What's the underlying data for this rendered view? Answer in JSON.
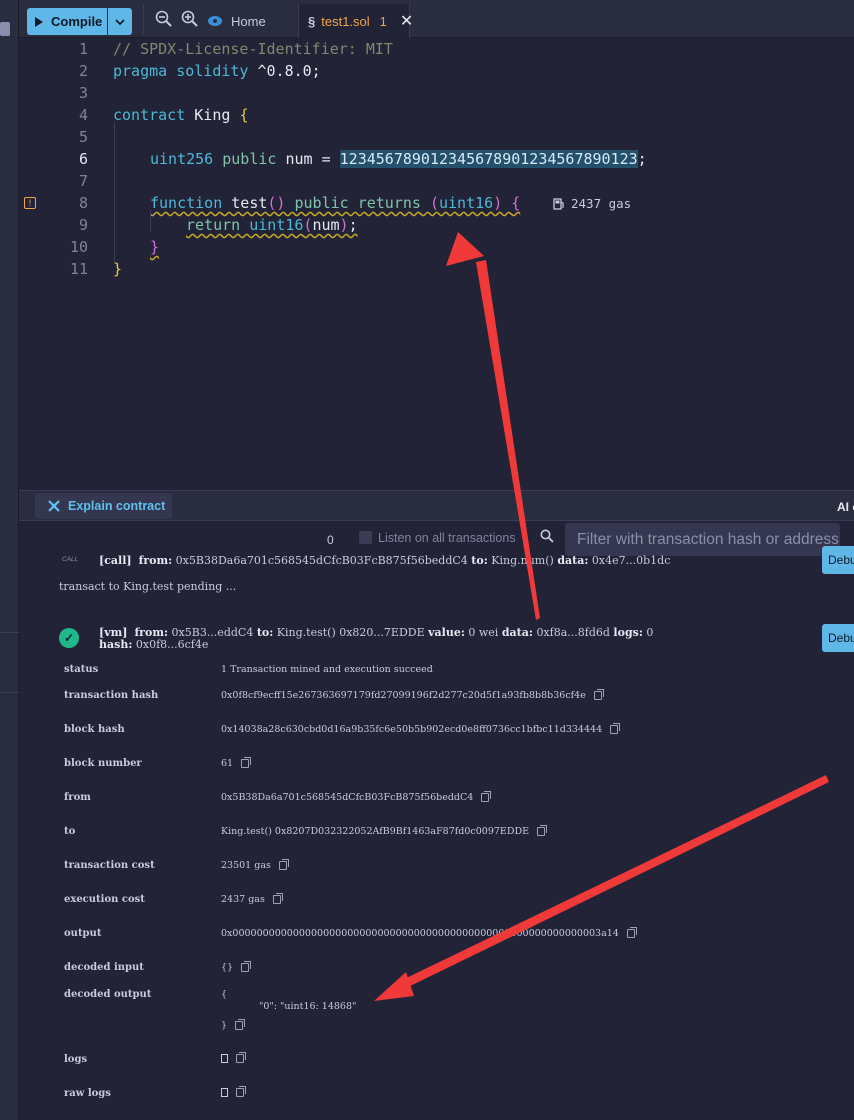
{
  "toolbar": {
    "compile_label": "Compile",
    "tabs": [
      {
        "label": "Home"
      },
      {
        "label": "test1.sol",
        "badge": "1"
      }
    ]
  },
  "editor": {
    "lines": [
      {
        "n": "1"
      },
      {
        "n": "2"
      },
      {
        "n": "3"
      },
      {
        "n": "4"
      },
      {
        "n": "5"
      },
      {
        "n": "6"
      },
      {
        "n": "7"
      },
      {
        "n": "8"
      },
      {
        "n": "9"
      },
      {
        "n": "10"
      },
      {
        "n": "11"
      }
    ],
    "code": {
      "l1": "// SPDX-License-Identifier: MIT",
      "l2_kw": "pragma",
      "l2_kw2": "solidity",
      "l2_rest": " ^0.8.0;",
      "l4_kw": "contract",
      "l4_name": " King ",
      "l4_br": "{",
      "l6_type": "uint256",
      "l6_pub": "public",
      "l6_rest": " num = ",
      "l6_num": "123456789012345678901234567890123",
      "l6_semi": ";",
      "l8_fn": "function",
      "l8_name": " test",
      "l8_parens": "()",
      "l8_pub": "public",
      "l8_ret": "returns",
      "l8_type": "uint16",
      "l8_br": "{",
      "l9_ret": "return",
      "l9_type": "uint16",
      "l9_arg": "num",
      "l10_br": "}",
      "l11_br": "}"
    },
    "gas_hint": "2437 gas"
  },
  "terminal": {
    "explain_label": "Explain contract",
    "ai_label": "AI co",
    "count": "0",
    "listen_label": "Listen on all transactions",
    "filter_placeholder": "Filter with transaction hash or address",
    "call_tag": "CALL",
    "call_line": {
      "tag": "[call]",
      "from_k": "from:",
      "from_v": "0x5B38Da6a701c568545dCfcB03FcB875f56beddC4",
      "to_k": "to:",
      "to_v": "King.num()",
      "data_k": "data:",
      "data_v": "0x4e7...0b1dc"
    },
    "pending_line": "transact to King.test pending ...",
    "vm_line": {
      "tag": "[vm]",
      "from_k": "from:",
      "from_v": "0x5B3...eddC4",
      "to_k": "to:",
      "to_v": "King.test() 0x820...7EDDE",
      "value_k": "value:",
      "value_v": "0 wei",
      "data_k": "data:",
      "data_v": "0xf8a...8fd6d",
      "logs_k": "logs:",
      "logs_v": "0",
      "hash_k": "hash:",
      "hash_v": "0x0f8...6cf4e"
    },
    "debug_label": "Debug",
    "details": [
      {
        "key": "status",
        "value": "1 Transaction mined and execution succeed"
      },
      {
        "key": "transaction hash",
        "value": "0x0f8cf9ecff15e267363697179fd27099196f2d277c20d5f1a93fb8b8b36cf4e"
      },
      {
        "key": "block hash",
        "value": "0x14038a28c630cbd0d16a9b35fc6e50b5b902ecd0e8ff0736cc1bfbc11d334444"
      },
      {
        "key": "block number",
        "value": "61"
      },
      {
        "key": "from",
        "value": "0x5B38Da6a701c568545dCfcB03FcB875f56beddC4"
      },
      {
        "key": "to",
        "value": "King.test() 0x8207D032322052AfB9Bf1463aF87fd0c0097EDDE"
      },
      {
        "key": "transaction cost",
        "value": "23501 gas"
      },
      {
        "key": "execution cost",
        "value": "2437 gas"
      },
      {
        "key": "output",
        "value": "0x0000000000000000000000000000000000000000000000000000000000003a14"
      },
      {
        "key": "decoded input",
        "value": "{}"
      },
      {
        "key": "decoded output",
        "value": "{"
      },
      {
        "key": "logs",
        "value": ""
      },
      {
        "key": "raw logs",
        "value": ""
      }
    ],
    "decoded_output_body": "\"0\": \"uint16: 14868\"",
    "decoded_output_close": "}"
  },
  "colors": {
    "accent": "#5fb7e8",
    "success": "#1fb88a",
    "warning": "#f0a54a",
    "annotation": "#f03a3a"
  }
}
